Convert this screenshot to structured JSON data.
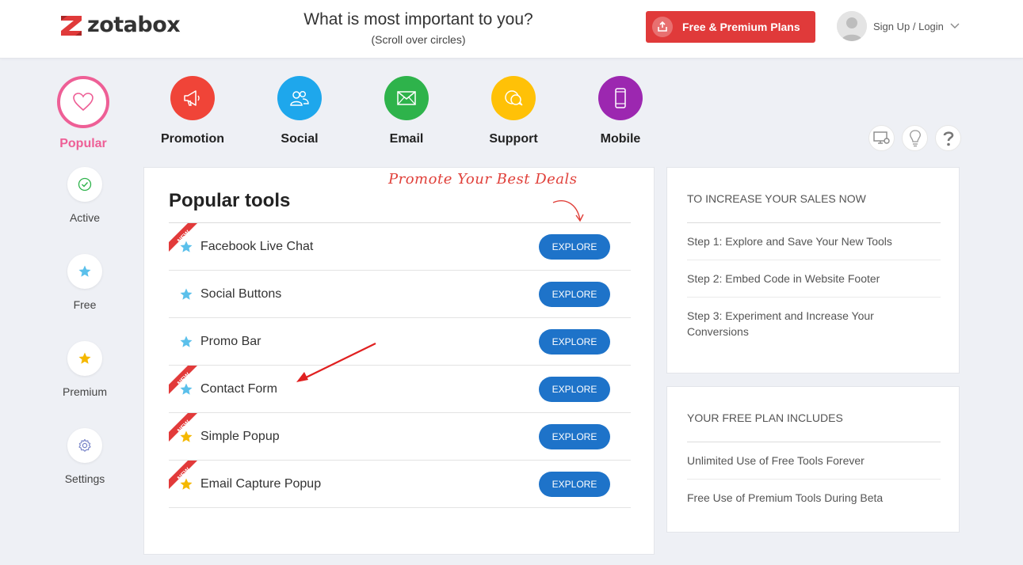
{
  "header": {
    "logo_text": "zotabox",
    "question": "What is most important to you?",
    "question_sub": "(Scroll over circles)",
    "plans_button": "Free & Premium Plans",
    "login_label": "Sign Up / Login"
  },
  "categories": [
    {
      "label": "Popular",
      "icon": "heart-icon",
      "color": "#ee5f96"
    },
    {
      "label": "Promotion",
      "icon": "megaphone-icon",
      "color": "#f04438"
    },
    {
      "label": "Social",
      "icon": "users-icon",
      "color": "#1ea7ec"
    },
    {
      "label": "Email",
      "icon": "envelope-icon",
      "color": "#2eb34b"
    },
    {
      "label": "Support",
      "icon": "chat-icon",
      "color": "#ffc107"
    },
    {
      "label": "Mobile",
      "icon": "mobile-icon",
      "color": "#9c27b0"
    }
  ],
  "side_nav": [
    {
      "label": "Active",
      "icon": "check-circle-icon"
    },
    {
      "label": "Free",
      "icon": "star-icon"
    },
    {
      "label": "Premium",
      "icon": "star-icon"
    },
    {
      "label": "Settings",
      "icon": "gear-icon"
    }
  ],
  "tool_icons": [
    "monitor-gear-icon",
    "lightbulb-icon",
    "question-icon"
  ],
  "main": {
    "title": "Popular tools",
    "promo_note": "Promote Your Best Deals",
    "new_badge": "NEW",
    "explore_label": "EXPLORE",
    "tools": [
      {
        "name": "Facebook Live Chat",
        "is_new": true,
        "tier": "free"
      },
      {
        "name": "Social Buttons",
        "is_new": false,
        "tier": "free"
      },
      {
        "name": "Promo Bar",
        "is_new": false,
        "tier": "free"
      },
      {
        "name": "Contact Form",
        "is_new": true,
        "tier": "free"
      },
      {
        "name": "Simple Popup",
        "is_new": true,
        "tier": "premium"
      },
      {
        "name": "Email Capture Popup",
        "is_new": true,
        "tier": "premium"
      }
    ]
  },
  "sales_panel": {
    "heading": "TO INCREASE YOUR SALES NOW",
    "steps": [
      "Step 1: Explore and Save Your New Tools",
      "Step 2: Embed Code in Website Footer",
      "Step 3: Experiment and Increase Your Conversions"
    ]
  },
  "free_plan_panel": {
    "heading": "YOUR FREE PLAN INCLUDES",
    "items": [
      "Unlimited Use of Free Tools Forever",
      "Free Use of Premium Tools During Beta"
    ]
  },
  "colors": {
    "accent_pink": "#ee5f96",
    "button_red": "#e03a3a",
    "button_blue": "#1e73c9",
    "star_free": "#5bc0eb",
    "star_premium": "#f5b800",
    "note_red": "#e0403a"
  }
}
